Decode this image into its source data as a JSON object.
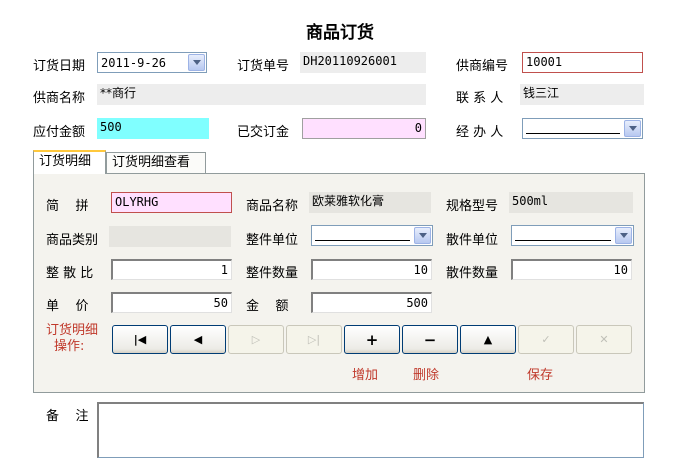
{
  "window": {
    "title": "商品订货"
  },
  "header": {
    "order_date": {
      "label": "订货日期",
      "value": "2011-9-26"
    },
    "order_no": {
      "label": "订货单号",
      "value": "DH20110926001"
    },
    "supplier_code": {
      "label": "供商编号",
      "value": "10001"
    },
    "supplier_name": {
      "label": "供商名称",
      "value": "**商行"
    },
    "contact": {
      "label": "联 系 人",
      "value": "钱三江"
    },
    "amount_due": {
      "label": "应付金额",
      "value": "500"
    },
    "paid_deposit": {
      "label": "已交订金",
      "value": "0"
    },
    "handler": {
      "label": "经 办 人",
      "value": ""
    }
  },
  "tabs": [
    {
      "label": "订货明细",
      "active": true
    },
    {
      "label": "订货明细查看",
      "active": false
    }
  ],
  "detail": {
    "pinyin": {
      "label": "简    拼",
      "value": "OLYRHG"
    },
    "product_name": {
      "label": "商品名称",
      "value": "欧莱雅软化膏"
    },
    "spec": {
      "label": "规格型号",
      "value": "500ml"
    },
    "category": {
      "label": "商品类别",
      "value": ""
    },
    "whole_unit": {
      "label": "整件单位",
      "value": ""
    },
    "loose_unit": {
      "label": "散件单位",
      "value": ""
    },
    "ratio": {
      "label": "整 散 比",
      "value": "1"
    },
    "whole_qty": {
      "label": "整件数量",
      "value": "10"
    },
    "loose_qty": {
      "label": "散件数量",
      "value": "10"
    },
    "unit_price": {
      "label": "单    价",
      "value": "50"
    },
    "amount": {
      "label": "金    额",
      "value": "500"
    }
  },
  "operations": {
    "label_line1": "订货明细",
    "label_line2": "操作:",
    "add_caption": "增加",
    "delete_caption": "删除",
    "save_caption": "保存"
  },
  "remarks": {
    "label": "备    注",
    "value": ""
  },
  "colors": {
    "amount_due_bg": "#80ffff",
    "paid_deposit_bg": "#ffe0ff",
    "pinyin_bg": "#ffe0ff",
    "caption_red": "#c0392b",
    "tab_highlight": "#ffc83c"
  }
}
